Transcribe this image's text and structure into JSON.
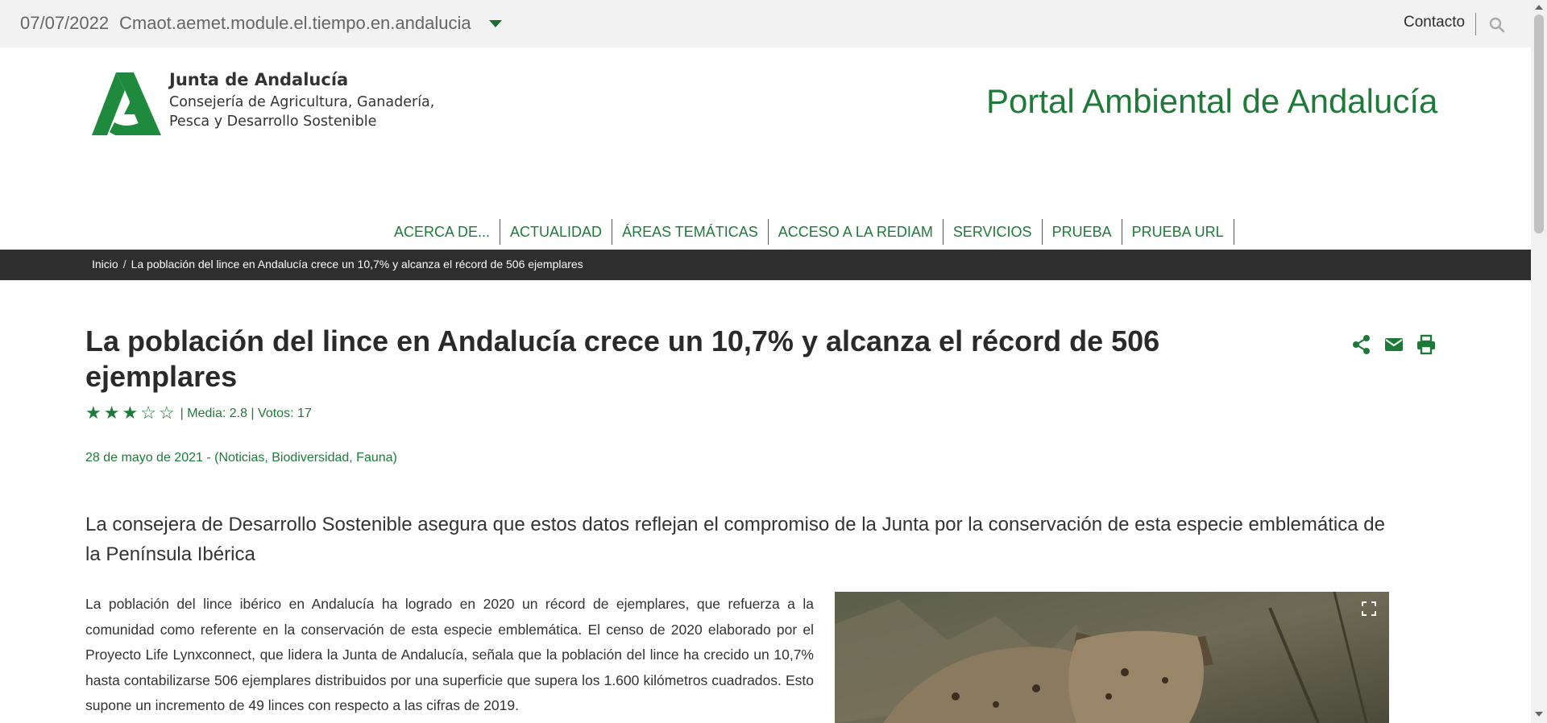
{
  "topbar": {
    "date": "07/07/2022",
    "module": "Cmaot.aemet.module.el.tiempo.en.andalucia",
    "contact": "Contacto"
  },
  "header": {
    "org_name": "Junta de Andalucía",
    "department_line1": "Consejería de Agricultura, Ganadería,",
    "department_line2": "Pesca y Desarrollo Sostenible",
    "portal_title": "Portal Ambiental de Andalucía"
  },
  "nav": {
    "items": [
      "ACERCA DE...",
      "ACTUALIDAD",
      "ÁREAS TEMÁTICAS",
      "ACCESO A LA REDIAM",
      "SERVICIOS",
      "PRUEBA",
      "PRUEBA URL"
    ]
  },
  "breadcrumb": {
    "home": "Inicio",
    "current": "La población del lince en Andalucía crece un 10,7% y alcanza el récord de 506 ejemplares"
  },
  "article": {
    "title": "La población del lince en Andalucía crece un 10,7% y alcanza el récord de 506 ejemplares",
    "rating_value": 3,
    "rating_max": 5,
    "rating_meta": "| Media: 2.8 | Votos: 17",
    "dateline": "28 de mayo de 2021 - (Noticias, Biodiversidad, Fauna)",
    "lead": "La consejera de Desarrollo Sostenible asegura que estos datos reflejan el compromiso de la Junta por la conservación de esta especie emblemática de la Península Ibérica",
    "body": "La población del lince ibérico en Andalucía ha logrado en 2020 un récord de ejemplares, que refuerza a la comunidad como referente en la conservación de esta especie emblemática. El censo de 2020 elaborado por el Proyecto Life Lynxconnect, que lidera la Junta de Andalucía, señala que la población del lince ha crecido un 10,7% hasta contabilizarse 506 ejemplares distribuidos por una superficie que supera los 1.600 kilómetros cuadrados. Esto supone un incremento de 49 linces con respecto a las cifras de 2019."
  },
  "icons": {
    "search": "search-icon",
    "share": "share-icon",
    "email": "email-icon",
    "print": "print-icon",
    "expand": "expand-icon"
  },
  "colors": {
    "accent": "#1f7a3a",
    "breadcrumb_bg": "#2e2e2e",
    "topbar_bg": "#f2f2f2"
  }
}
